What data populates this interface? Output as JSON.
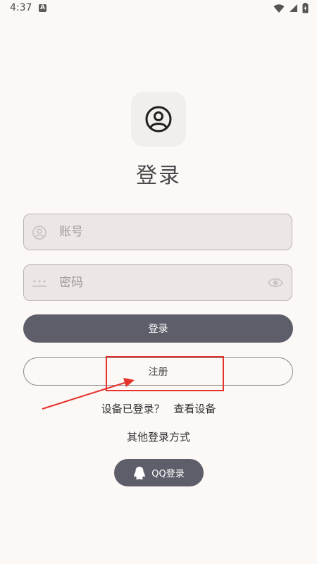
{
  "status_bar": {
    "time": "4:37",
    "notification_badge": "A",
    "icons": [
      "wifi-icon",
      "signal-icon",
      "battery-charging-icon"
    ]
  },
  "login": {
    "title": "登录",
    "account_placeholder": "账号",
    "password_placeholder": "密码",
    "login_label": "登录",
    "register_label": "注册",
    "device_logged_in_text": "设备已登录？",
    "view_devices_link": "查看设备",
    "other_methods_title": "其他登录方式",
    "qq_login_label": "QQ登录"
  },
  "annotation": {
    "highlight_color": "#e5322d"
  },
  "colors": {
    "background": "#fcf8f6",
    "primary_button": "#5d5e6a",
    "field_fill": "#ece7e5"
  }
}
